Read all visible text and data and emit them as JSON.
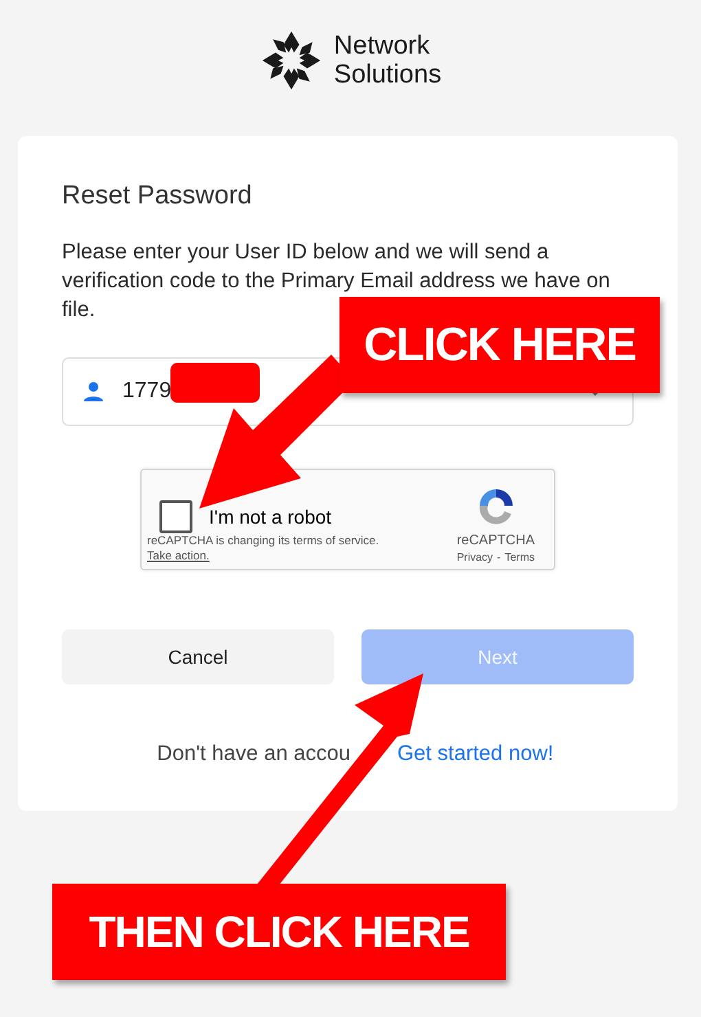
{
  "logo": {
    "line1": "Network",
    "line2": "Solutions"
  },
  "card": {
    "title": "Reset Password",
    "instructions": "Please enter your User ID below and we will send a verification code to the Primary Email address we have on file.",
    "user_id": {
      "value": "1779"
    },
    "captcha": {
      "label": "I'm not a robot",
      "checked": false,
      "notice": "reCAPTCHA is changing its terms of service.",
      "notice_link": "Take action.",
      "brand": "reCAPTCHA",
      "privacy": "Privacy",
      "separator": "-",
      "terms": "Terms"
    },
    "buttons": [
      {
        "label": "Cancel",
        "kind": "secondary",
        "disabled": false
      },
      {
        "label": "Next",
        "kind": "primary",
        "disabled": true
      }
    ],
    "signup_text": "Don't have an accou",
    "signup_link": "Get started now!"
  },
  "callouts": [
    {
      "text": "CLICK HERE"
    },
    {
      "text": "THEN CLICK HERE"
    }
  ]
}
